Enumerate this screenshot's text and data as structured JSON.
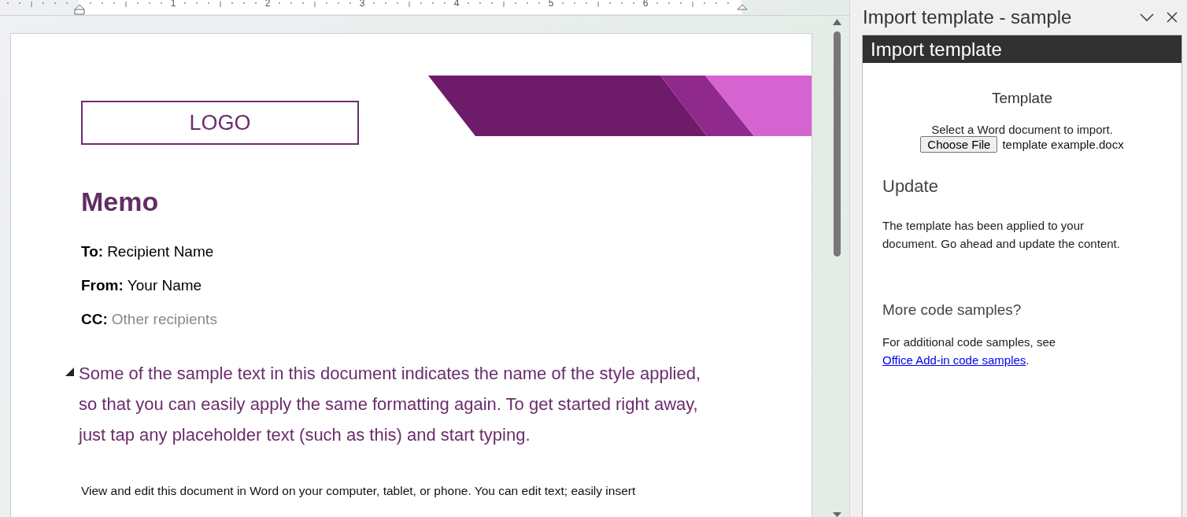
{
  "ruler": {
    "numbers": [
      "1",
      "2",
      "3",
      "4",
      "5",
      "6"
    ]
  },
  "document": {
    "logo": "LOGO",
    "heading": "Memo",
    "fields": [
      {
        "label": "To:",
        "value": "Recipient Name",
        "kind": "value"
      },
      {
        "label": "From:",
        "value": "Your Name",
        "kind": "value"
      },
      {
        "label": "CC:",
        "value": "Other recipients",
        "kind": "hint"
      }
    ],
    "paragraph": "Some of the sample text in this document indicates the name of the style applied, so that you can easily apply the same formatting again. To get started right away, just tap any placeholder text (such as this) and start typing.",
    "body": "View and edit this document in Word on your computer, tablet, or phone. You can edit text; easily insert"
  },
  "task_pane": {
    "title": "Import template - sample",
    "header": "Import template",
    "template_section": {
      "heading": "Template",
      "instruction": "Select a Word document to import.",
      "button": "Choose File",
      "file_name": "template example.docx"
    },
    "update_section": {
      "heading": "Update",
      "text": "The template has been applied to your document. Go ahead and update the content."
    },
    "samples_section": {
      "heading": "More code samples?",
      "text": "For additional code samples, see",
      "link": "Office Add-in code samples",
      "text_end": "."
    }
  }
}
